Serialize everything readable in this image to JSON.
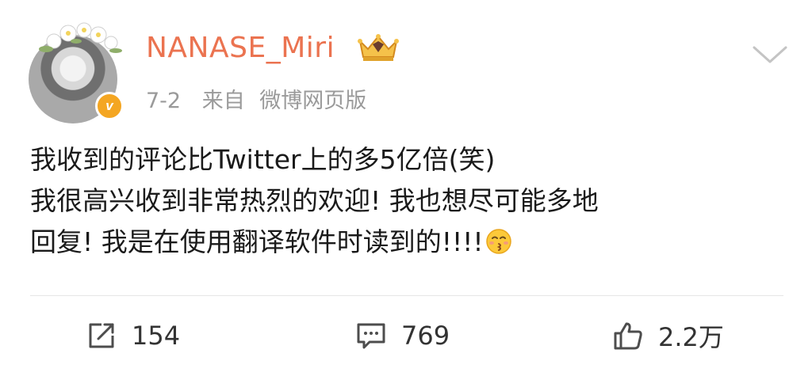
{
  "post": {
    "username": "NANASE_Miri",
    "date": "7-2",
    "source_prefix": "来自",
    "source": "微博网页版",
    "verified_badge_letter": "v",
    "content_lines": [
      "我收到的评论比Twitter上的多5亿倍(笑)",
      "我很高兴收到非常热烈的欢迎! 我也想尽可能多地",
      "回复! 我是在使用翻译软件时读到的!!!!"
    ],
    "content_emoji": "kissing-face-icon",
    "user_badge_icon": "crown-icon"
  },
  "actions": {
    "repost_count": "154",
    "comment_count": "769",
    "like_count": "2.2万"
  },
  "colors": {
    "username": "#eb7350",
    "meta": "#9a9a9a",
    "badge": "#f4a622"
  }
}
